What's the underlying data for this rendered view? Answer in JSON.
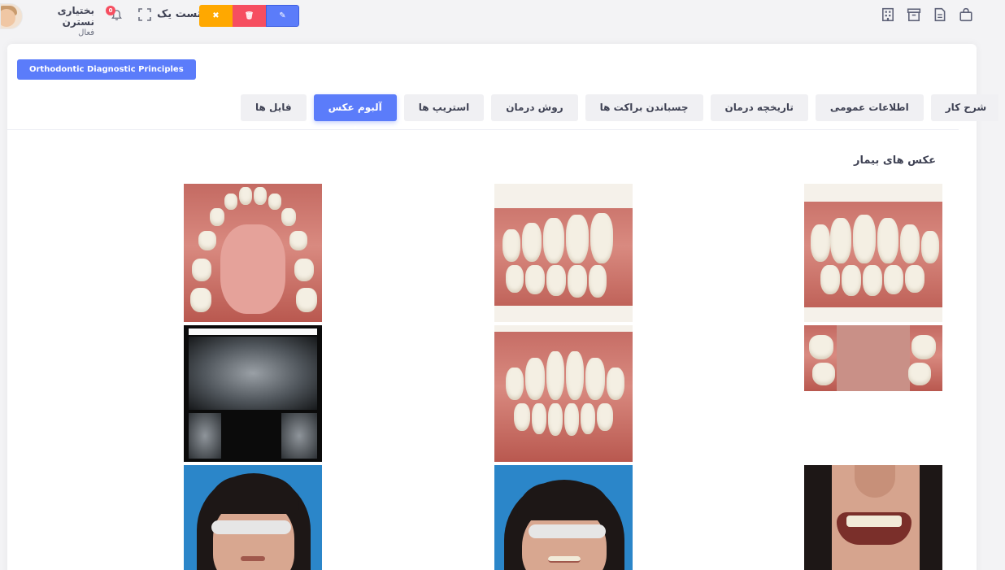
{
  "header": {
    "user_name": "بختیاری نسترن",
    "user_status": "فعال",
    "notification_count": "0",
    "test_label": "تست یک",
    "btn_cancel": "✖",
    "btn_delete": "🗑",
    "btn_edit": "✎"
  },
  "card": {
    "title_badge": "Orthodontic Diagnostic Principles",
    "tabs": [
      {
        "label": "شرح کار",
        "active": false
      },
      {
        "label": "اطلاعات عمومی",
        "active": false
      },
      {
        "label": "تاریخچه درمان",
        "active": false
      },
      {
        "label": "چسباندن براکت ها",
        "active": false
      },
      {
        "label": "روش درمان",
        "active": false
      },
      {
        "label": "استریپ ها",
        "active": false
      },
      {
        "label": "آلبوم عکس",
        "active": true
      },
      {
        "label": "فایل ها",
        "active": false
      }
    ],
    "section_title": "عکس های بیمار"
  },
  "colors": {
    "primary": "#5b7cfa",
    "warning": "#ffa800",
    "danger": "#f64e60",
    "tab_bg": "#f0f0f3"
  }
}
